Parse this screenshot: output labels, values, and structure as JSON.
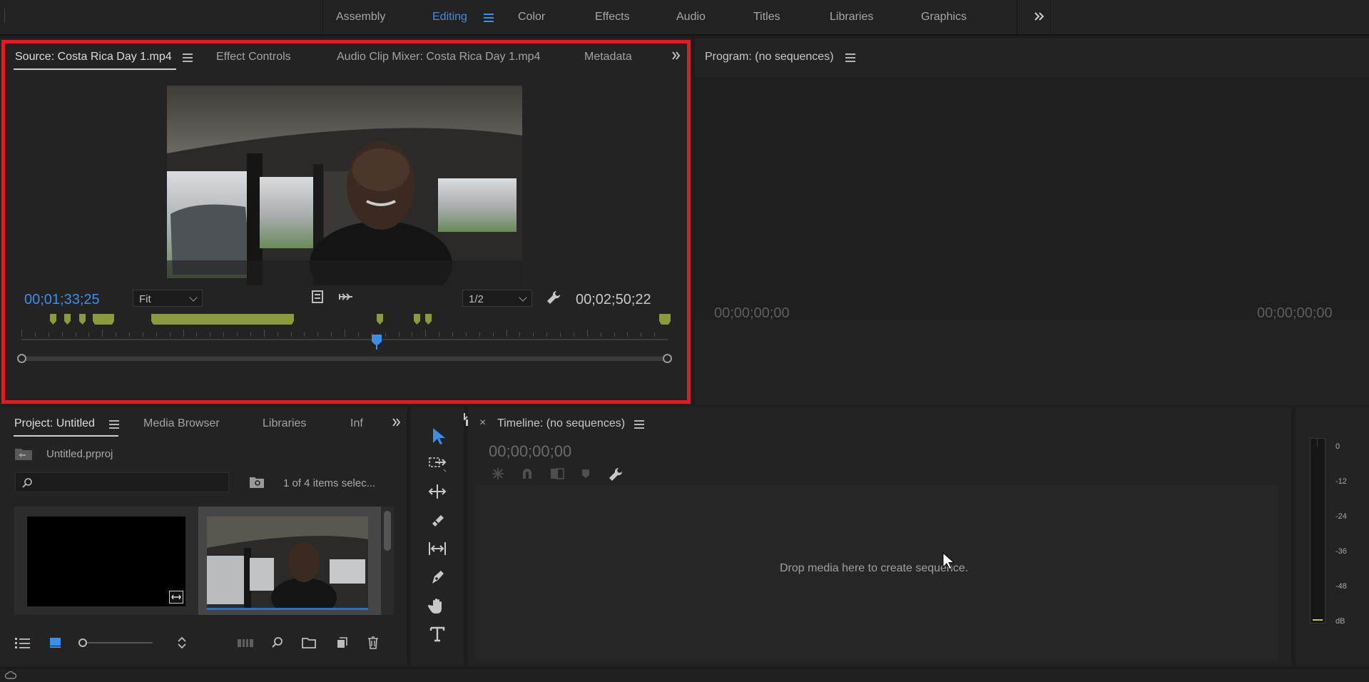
{
  "workspaces": {
    "tabs": [
      "Assembly",
      "Editing",
      "Color",
      "Effects",
      "Audio",
      "Titles",
      "Libraries",
      "Graphics"
    ],
    "active": "Editing"
  },
  "source_panel": {
    "tabs": {
      "source": "Source: Costa Rica Day 1.mp4",
      "effect_controls": "Effect Controls",
      "audio_clip_mixer": "Audio Clip Mixer: Costa Rica Day 1.mp4",
      "metadata": "Metadata"
    },
    "timecode_current": "00;01;33;25",
    "timecode_duration": "00;02;50;22",
    "zoom_select": "Fit",
    "resolution_select": "1/2",
    "playhead_position": 0.55
  },
  "program_panel": {
    "title": "Program: (no sequences)",
    "timecode_left": "00;00;00;00",
    "timecode_right": "00;00;00;00"
  },
  "project_panel": {
    "tabs": {
      "project": "Project: Untitled",
      "media_browser": "Media Browser",
      "libraries": "Libraries",
      "info": "Inf"
    },
    "filename": "Untitled.prproj",
    "search_placeholder": "",
    "selection_status": "1 of 4 items selec..."
  },
  "timeline_panel": {
    "title": "Timeline: (no sequences)",
    "timecode": "00;00;00;00",
    "empty_message": "Drop media here to create sequence."
  },
  "audio_meter": {
    "scale": [
      "0",
      "-12",
      "-24",
      "-36",
      "-48",
      "dB"
    ]
  },
  "colors": {
    "accent_blue": "#3d8ee8",
    "highlight_red": "#e01b24",
    "clip_marker_green": "#8a9a3c",
    "panel_bg": "#232323"
  }
}
